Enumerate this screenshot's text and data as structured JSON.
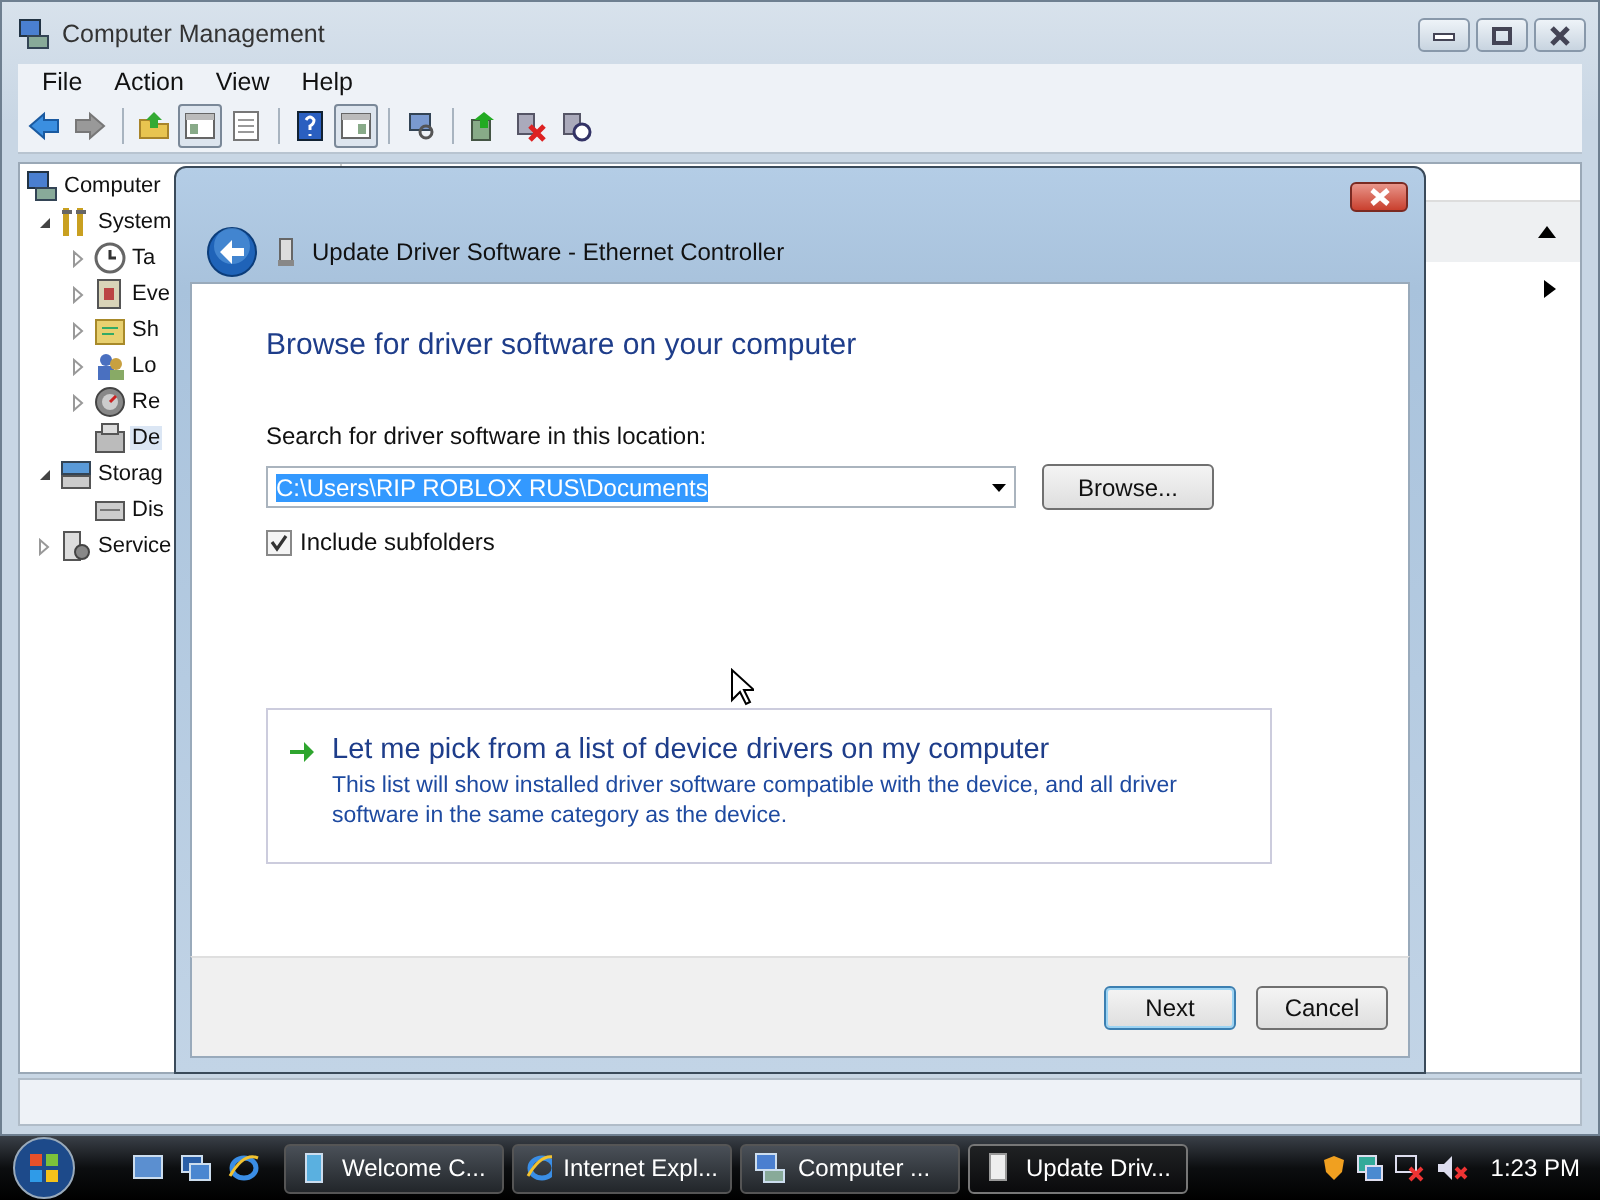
{
  "window": {
    "title": "Computer Management"
  },
  "menu": [
    "File",
    "Action",
    "View",
    "Help"
  ],
  "toolbar": [
    {
      "kind": "back",
      "pressed": false
    },
    {
      "kind": "forward",
      "pressed": false
    },
    {
      "kind": "sep"
    },
    {
      "kind": "up",
      "pressed": false
    },
    {
      "kind": "tree",
      "pressed": true
    },
    {
      "kind": "list",
      "pressed": false
    },
    {
      "kind": "sep"
    },
    {
      "kind": "help",
      "pressed": false
    },
    {
      "kind": "pane",
      "pressed": true
    },
    {
      "kind": "sep"
    },
    {
      "kind": "scan",
      "pressed": false
    },
    {
      "kind": "sep"
    },
    {
      "kind": "update",
      "pressed": false
    },
    {
      "kind": "remove",
      "pressed": false
    },
    {
      "kind": "rollback",
      "pressed": false
    }
  ],
  "tree": [
    {
      "label": "Computer",
      "children": [
        {
          "label": "System",
          "expanded": true,
          "children": [
            {
              "label": "Ta",
              "expanded": false
            },
            {
              "label": "Eve",
              "expanded": false
            },
            {
              "label": "Sh",
              "expanded": false
            },
            {
              "label": "Lo",
              "expanded": false
            },
            {
              "label": "Re",
              "expanded": false
            },
            {
              "label": "De",
              "selected": true
            }
          ]
        },
        {
          "label": "Storag",
          "expanded": true,
          "children": [
            {
              "label": "Dis",
              "selected": false
            }
          ]
        },
        {
          "label": "Service",
          "expanded": false
        }
      ]
    }
  ],
  "dialog": {
    "title": "Update Driver Software - Ethernet Controller",
    "heading": "Browse for driver software on your computer",
    "location_label": "Search for driver software in this location:",
    "location": {
      "value": "C:\\Users\\RIP ROBLOX RUS\\Documents",
      "highlighted": true
    },
    "browse_button": "Browse...",
    "include_subfolders": {
      "label": "Include subfolders",
      "checked": true
    },
    "option": {
      "title": "Let me pick from a list of device drivers on my computer",
      "description": "This list will show installed driver software compatible with the device, and all driver software in the same category as the device."
    },
    "buttons": [
      {
        "label": "Next",
        "default": true
      },
      {
        "label": "Cancel",
        "default": false
      }
    ]
  },
  "taskbar": {
    "tasks": [
      {
        "label": "Welcome C...",
        "selected": false
      },
      {
        "label": "Internet Expl...",
        "selected": false
      },
      {
        "label": "Computer ...",
        "selected": false
      },
      {
        "label": "Update Driv...",
        "selected": true
      }
    ],
    "clock": "1:23 PM"
  }
}
